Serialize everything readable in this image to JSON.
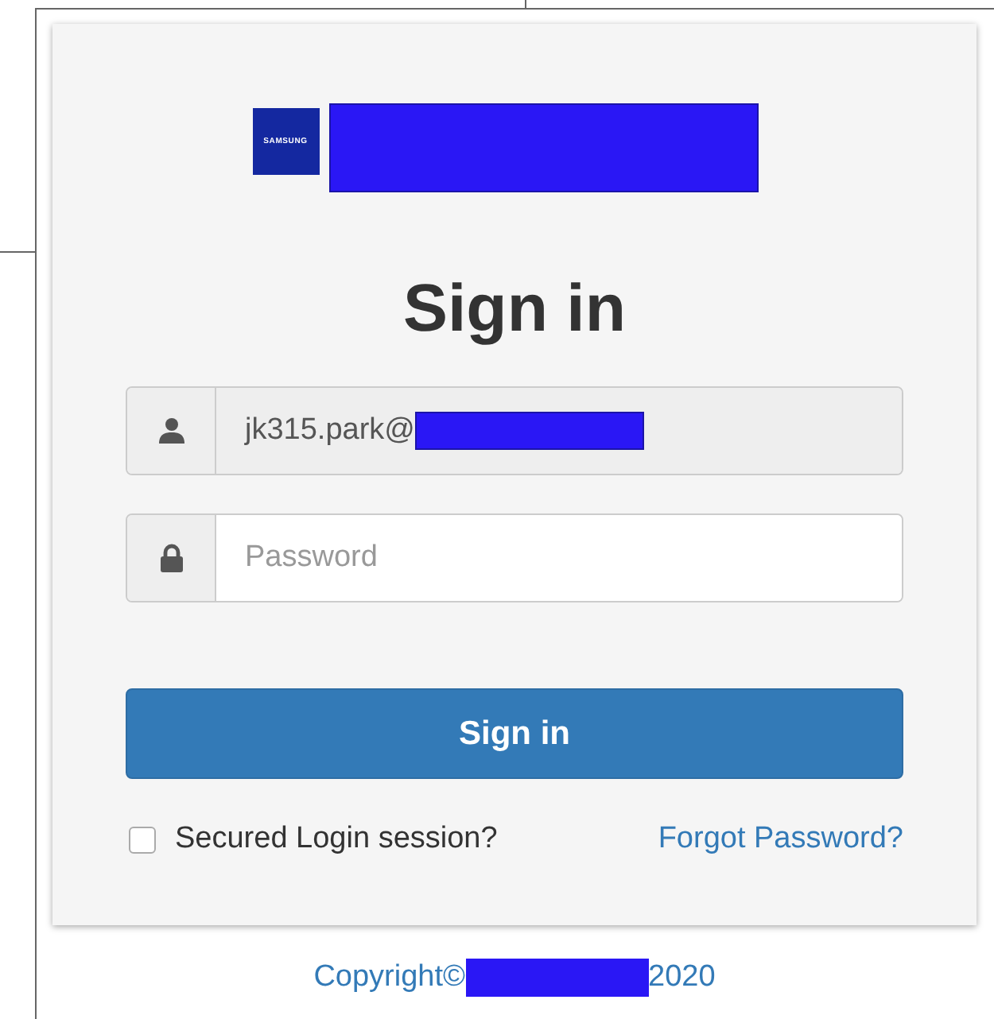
{
  "logo": {
    "text": "SAMSUNG"
  },
  "title": "Sign in",
  "fields": [
    {
      "kind": "user",
      "value": "jk315.park@",
      "readonly": true,
      "redacted": true
    },
    {
      "kind": "lock",
      "placeholder": "Password",
      "readonly": false,
      "redacted": false
    }
  ],
  "submit": "Sign in",
  "remember": {
    "label": "Secured Login session?",
    "checked": false
  },
  "forgot_link": "Forgot Password?",
  "footer": {
    "copyright_start": "Copyright©",
    "copyright_end": "2020"
  }
}
